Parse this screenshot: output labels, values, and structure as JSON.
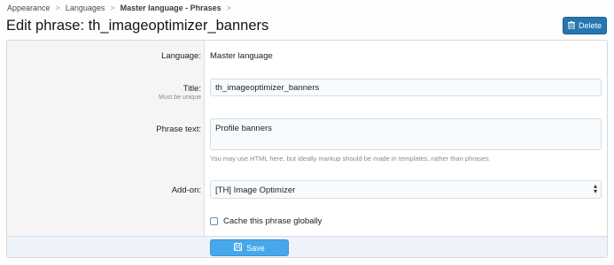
{
  "breadcrumb": {
    "items": [
      "Appearance",
      "Languages",
      "Master language - Phrases"
    ]
  },
  "page_title": "Edit phrase: th_imageoptimizer_banners",
  "header": {
    "delete_label": "Delete"
  },
  "form": {
    "language": {
      "label": "Language:",
      "value": "Master language"
    },
    "title": {
      "label": "Title:",
      "hint": "Must be unique",
      "value": "th_imageoptimizer_banners"
    },
    "phrase_text": {
      "label": "Phrase text:",
      "value": "Profile banners",
      "explain": "You may use HTML here, but ideally markup should be made in templates, rather than phrases."
    },
    "addon": {
      "label": "Add-on:",
      "value": "[TH] Image Optimizer"
    },
    "cache_label": "Cache this phrase globally",
    "save_label": "Save"
  },
  "colors": {
    "accent": "#2577b1",
    "save_button": "#47a7eb"
  }
}
